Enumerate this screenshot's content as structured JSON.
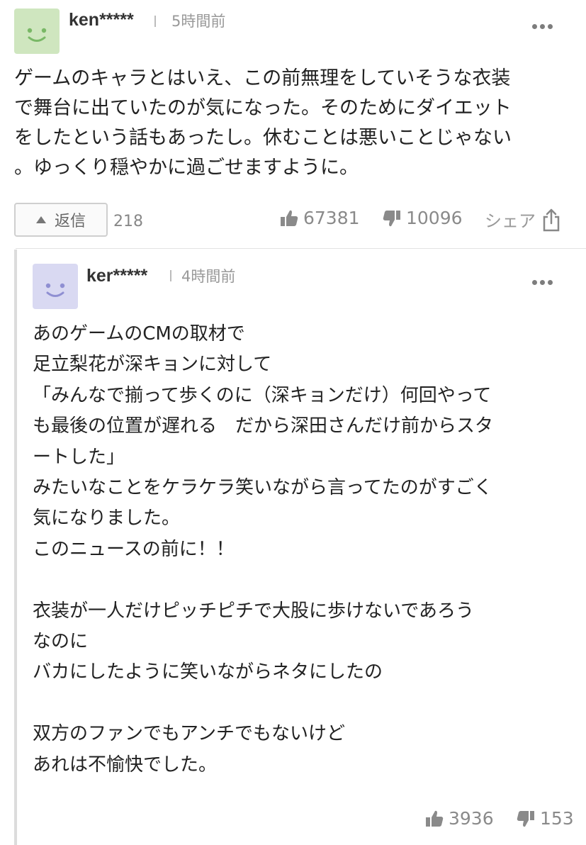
{
  "colors": {
    "avatar_green": "#cfe6bf",
    "avatar_purple": "#d9d9f2",
    "text": "#222222",
    "muted": "#8a8a8a"
  },
  "comment": {
    "username": "ken*****",
    "time": "5時間前",
    "more_icon": "ellipsis-icon",
    "body": "ゲームのキャラとはいえ、この前無理をしていそうな衣装\nで舞台に出ていたのが気になった。そのためにダイエット\nをしたという話もあったし。休むことは悪いことじゃない\n。ゆっくり穏やかに過ごせますように。",
    "reply_label": "返信",
    "reply_count": "218",
    "likes": "67381",
    "dislikes": "10096",
    "share_label": "シェア"
  },
  "reply": {
    "username": "ker*****",
    "time": "4時間前",
    "more_icon": "ellipsis-icon",
    "body": "あのゲームのCMの取材で\n足立梨花が深キョンに対して\n「みんなで揃って歩くのに（深キョンだけ）何回やって\nも最後の位置が遅れる　だから深田さんだけ前からスタ\nートした」\nみたいなことをケラケラ笑いながら言ってたのがすごく\n気になりました。\nこのニュースの前に！！\n\n衣装が一人だけピッチピチで大股に歩けないであろう\nなのに\nバカにしたように笑いながらネタにしたの\n\n双方のファンでもアンチでもないけど\nあれは不愉快でした。",
    "likes": "3936",
    "dislikes": "153"
  }
}
